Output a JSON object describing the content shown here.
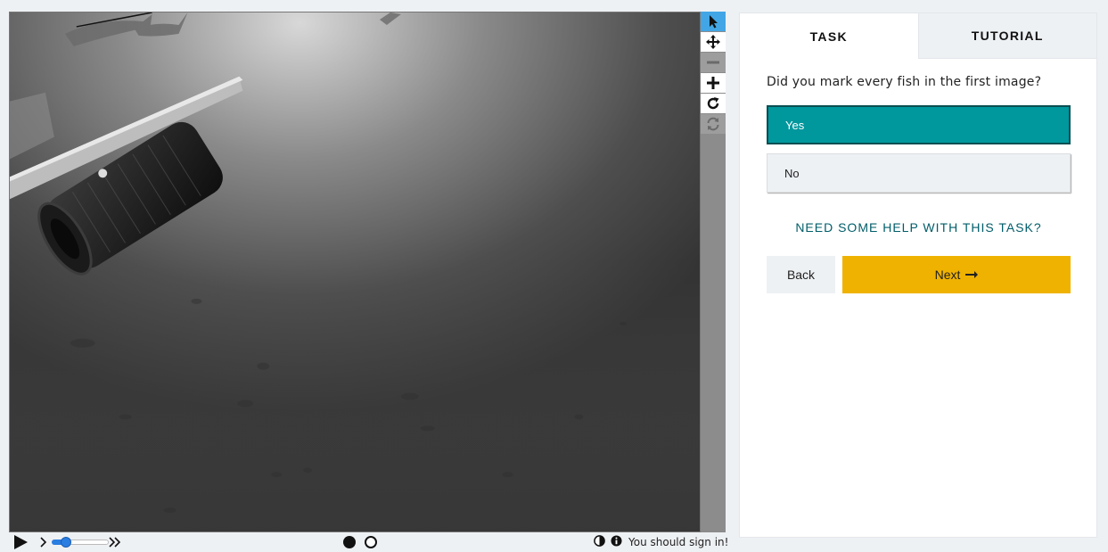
{
  "viewer": {
    "image_alt": "",
    "tools": [
      {
        "name": "select-tool",
        "icon": "pointer-icon",
        "state": "active"
      },
      {
        "name": "move-tool",
        "icon": "move-arrows-icon",
        "state": "normal"
      },
      {
        "name": "zoom-out-tool",
        "icon": "minus-icon",
        "state": "disabled"
      },
      {
        "name": "zoom-in-tool",
        "icon": "plus-icon",
        "state": "normal"
      },
      {
        "name": "rotate-tool",
        "icon": "rotate-icon",
        "state": "normal"
      },
      {
        "name": "reset-tool",
        "icon": "refresh-icon",
        "state": "disabled"
      }
    ]
  },
  "controls": {
    "speed_level": 0.2,
    "frames": {
      "count": 2,
      "current": 1
    },
    "signin_message": "You should sign in!"
  },
  "panel": {
    "tabs": [
      {
        "label": "TASK",
        "active": true
      },
      {
        "label": "TUTORIAL",
        "active": false
      }
    ],
    "question": "Did you mark every fish in the first image?",
    "answers": [
      {
        "label": "Yes",
        "selected": true
      },
      {
        "label": "No",
        "selected": false
      }
    ],
    "help_link": "NEED SOME HELP WITH THIS TASK?",
    "back_label": "Back",
    "next_label": "Next"
  },
  "colors": {
    "accent_teal": "#00979d",
    "next_yellow": "#f0b200",
    "active_tool_blue": "#42a6e6",
    "help_link": "#005d69"
  }
}
